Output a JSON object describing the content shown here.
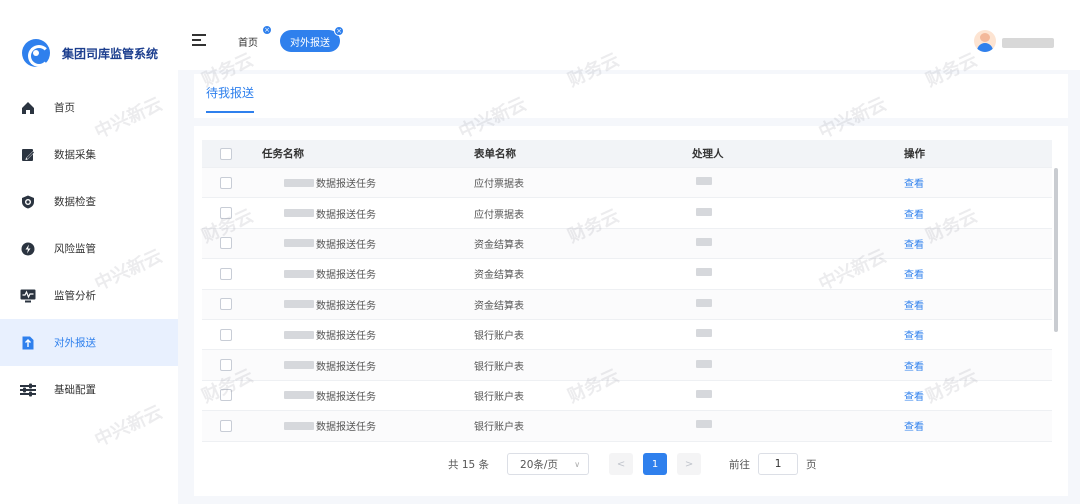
{
  "brand": {
    "title": "集团司库监管系统"
  },
  "sidebar": {
    "items": [
      {
        "label": "首页",
        "icon": "home-icon",
        "active": false
      },
      {
        "label": "数据采集",
        "icon": "edit-icon",
        "active": false
      },
      {
        "label": "数据检查",
        "icon": "shield-icon",
        "active": false
      },
      {
        "label": "风险监管",
        "icon": "lightning-icon",
        "active": false
      },
      {
        "label": "监管分析",
        "icon": "monitor-chart-icon",
        "active": false
      },
      {
        "label": "对外报送",
        "icon": "document-upload-icon",
        "active": true
      },
      {
        "label": "基础配置",
        "icon": "sliders-icon",
        "active": false
      }
    ]
  },
  "tabs": {
    "home": "首页",
    "active": "对外报送"
  },
  "subtab": {
    "label": "待我报送"
  },
  "table": {
    "headers": {
      "task": "任务名称",
      "form": "表单名称",
      "handler": "处理人",
      "op": "操作"
    },
    "rows": [
      {
        "task": "数据报送任务",
        "form": "应付票据表",
        "op": "查看"
      },
      {
        "task": "数据报送任务",
        "form": "应付票据表",
        "op": "查看"
      },
      {
        "task": "数据报送任务",
        "form": "资金结算表",
        "op": "查看"
      },
      {
        "task": "数据报送任务",
        "form": "资金结算表",
        "op": "查看"
      },
      {
        "task": "数据报送任务",
        "form": "资金结算表",
        "op": "查看"
      },
      {
        "task": "数据报送任务",
        "form": "银行账户表",
        "op": "查看"
      },
      {
        "task": "数据报送任务",
        "form": "银行账户表",
        "op": "查看"
      },
      {
        "task": "数据报送任务",
        "form": "银行账户表",
        "op": "查看"
      },
      {
        "task": "数据报送任务",
        "form": "银行账户表",
        "op": "查看"
      }
    ]
  },
  "pagination": {
    "total": "共 15 条",
    "page_size": "20条/页",
    "prev": "<",
    "current": "1",
    "next": ">",
    "goto_label": "前往",
    "goto_value": "1",
    "goto_suffix": "页"
  },
  "watermark": {
    "text_a": "中兴新云",
    "text_b": "财务云"
  },
  "colors": {
    "accent": "#2f80ed",
    "brand_text": "#1d3f8f",
    "active_bg": "#e8f0fe"
  }
}
